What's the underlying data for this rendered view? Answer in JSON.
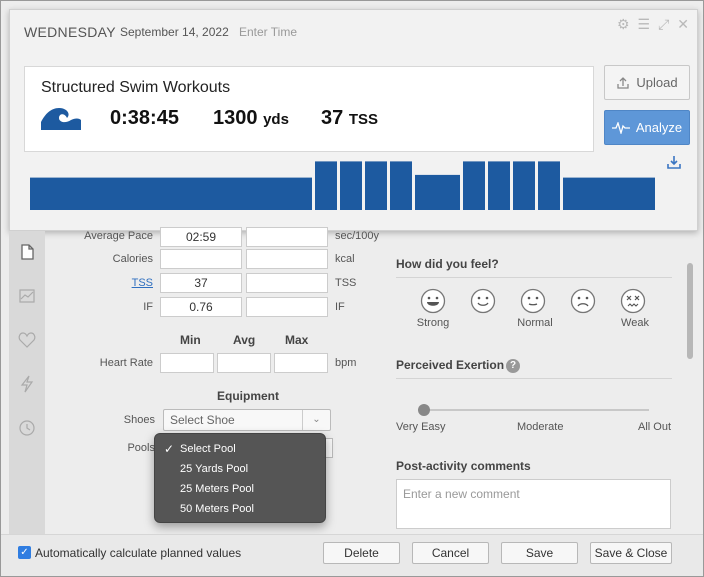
{
  "header": {
    "day": "WEDNESDAY",
    "date": "September 14, 2022",
    "time_placeholder": "Enter Time",
    "icons": [
      "gear-icon",
      "menu-icon",
      "expand-icon",
      "close-icon"
    ]
  },
  "summary": {
    "title": "Structured Swim Workouts",
    "sport_icon": "wave-icon",
    "duration": "0:38:45",
    "distance_value": "1300",
    "distance_unit": "yds",
    "tss_value": "37",
    "tss_unit": "TSS",
    "upload_label": "Upload",
    "analyze_label": "Analyze",
    "bar_color": "#1d5aa0"
  },
  "chart_data": {
    "type": "bar",
    "description_values": "relative workout intensity blocks",
    "values": [
      0.6,
      0.9,
      0.9,
      0.9,
      0.9,
      0.65,
      0.9,
      0.9,
      0.9,
      0.9,
      0.6
    ],
    "widths": [
      282,
      22,
      22,
      22,
      22,
      45,
      22,
      22,
      22,
      22,
      92
    ]
  },
  "form": {
    "avg_pace": {
      "label": "Average Pace",
      "planned": "02:59",
      "completed": "",
      "unit": "sec/100y"
    },
    "calories": {
      "label": "Calories",
      "planned": "",
      "completed": "",
      "unit": "kcal"
    },
    "tss": {
      "label": "TSS",
      "planned": "37",
      "completed": "",
      "unit": "TSS"
    },
    "if": {
      "label": "IF",
      "planned": "0.76",
      "completed": "",
      "unit": "IF"
    },
    "hr_headers": {
      "min": "Min",
      "avg": "Avg",
      "max": "Max"
    },
    "heart_rate": {
      "label": "Heart Rate",
      "unit": "bpm"
    },
    "equipment_title": "Equipment",
    "shoes_label": "Shoes",
    "shoes_value": "Select Shoe",
    "pools_label": "Pools"
  },
  "pool_menu": {
    "items": [
      "Select Pool",
      "25 Yards Pool",
      "25 Meters Pool",
      "50 Meters Pool"
    ],
    "selected": "Select Pool"
  },
  "feel": {
    "title": "How did you feel?",
    "labels": [
      "Strong",
      "Normal",
      "Weak"
    ]
  },
  "exertion": {
    "title": "Perceived Exertion",
    "help": "?",
    "labels": [
      "Very Easy",
      "Moderate",
      "All Out"
    ],
    "level": 0
  },
  "comments": {
    "title": "Post-activity comments",
    "placeholder": "Enter a new comment"
  },
  "footer": {
    "auto_calc_label": "Automatically calculate planned values",
    "auto_calc_checked": true,
    "delete_label": "Delete",
    "cancel_label": "Cancel",
    "save_label": "Save",
    "save_close_label": "Save & Close"
  }
}
